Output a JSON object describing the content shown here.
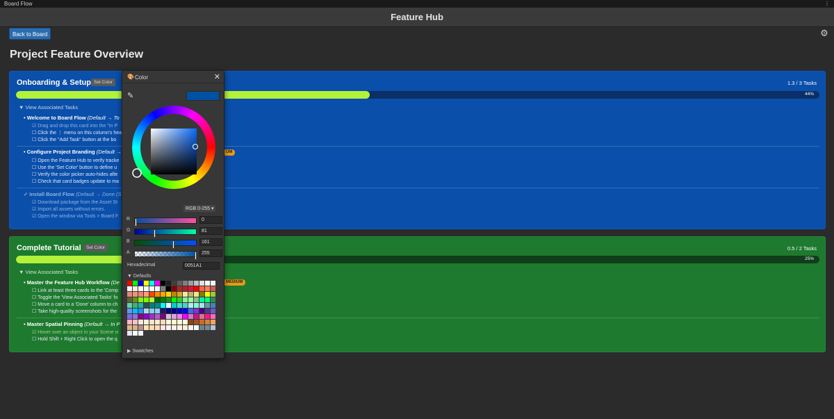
{
  "window": {
    "title": "Board Flow",
    "menu_icon": "kebab-icon"
  },
  "header": {
    "title": "Feature Hub"
  },
  "toolbar": {
    "back_label": "Back to Board",
    "settings_icon": "gear-icon"
  },
  "page_title": "Project Feature Overview",
  "set_color_label": "Set Color",
  "assoc_label": "View Associated Tasks",
  "panels": {
    "onboarding": {
      "title": "Onboarding & Setup",
      "color": "#0a4faa",
      "task_count": "1.3 / 3 Tasks",
      "progress_fraction": 0.44,
      "progress_label": "44%",
      "tasks": [
        {
          "name": "Welcome to Board Flow",
          "flow": "(Default → To",
          "subs": [
            {
              "text": "Drag and drop this card into the \"In P",
              "done": true
            },
            {
              "text": "Click the ⋮ menu on this column's hea",
              "done": false
            },
            {
              "text": "Click the \"Add Task\" button at the bo",
              "done": false
            }
          ]
        },
        {
          "name": "Configure Project Branding",
          "flow": "(Default →",
          "badge": "UM",
          "subs": [
            {
              "text": "Open the Feature Hub to verify tracke",
              "done": false
            },
            {
              "text": "Use the 'Set Color' button to define u",
              "done": false
            },
            {
              "text": "Verify the color picker auto-hides afte",
              "done": false
            },
            {
              "text": "Check that card badges update to ma",
              "done": false
            }
          ]
        },
        {
          "name": "Install Board Flow",
          "flow": "(Default → Done (S",
          "done": true,
          "subs": [
            {
              "text": "Download package from the Asset St",
              "done": true
            },
            {
              "text": "Import all assets without errors.",
              "done": true
            },
            {
              "text": "Open the window via Tools > Board F",
              "done": true
            }
          ]
        }
      ]
    },
    "tutorial": {
      "title": "Complete Tutorial",
      "color": "#1e7a2e",
      "task_count": "0.5 / 2 Tasks",
      "progress_fraction": 0.25,
      "progress_label": "25%",
      "tasks": [
        {
          "name": "Master the Feature Hub Workflow",
          "flow": "(De",
          "badge": "MEDIUM",
          "subs": [
            {
              "text": "Link at least three cards to the 'Comp",
              "done": false
            },
            {
              "text": "Toggle the 'View Associated Tasks' fo",
              "done": false
            },
            {
              "text": "Move a card to a 'Done' column to ch",
              "done": false
            },
            {
              "text": "Take high-quality screenshots for the",
              "done": false
            }
          ]
        },
        {
          "name": "Master Spatial Pinning",
          "flow": "(Default → In P",
          "subs": [
            {
              "text": "Hover over an object in your Scene vi",
              "done": true
            },
            {
              "text": "Hold Shift + Right Click to open the q",
              "done": false
            }
          ]
        }
      ]
    }
  },
  "picker": {
    "title": "Color",
    "current_color": "#0051A1",
    "format": "RGB 0-255 ▾",
    "channels": [
      {
        "label": "R",
        "value": "0",
        "fraction": 0.0
      },
      {
        "label": "G",
        "value": "81",
        "fraction": 0.318
      },
      {
        "label": "B",
        "value": "161",
        "fraction": 0.631
      },
      {
        "label": "A",
        "value": "255",
        "fraction": 1.0
      }
    ],
    "hex_label": "Hexadecimal",
    "hex_value": "0051A1",
    "defaults_label": "Defaults",
    "swatches_label": "Swatches"
  }
}
